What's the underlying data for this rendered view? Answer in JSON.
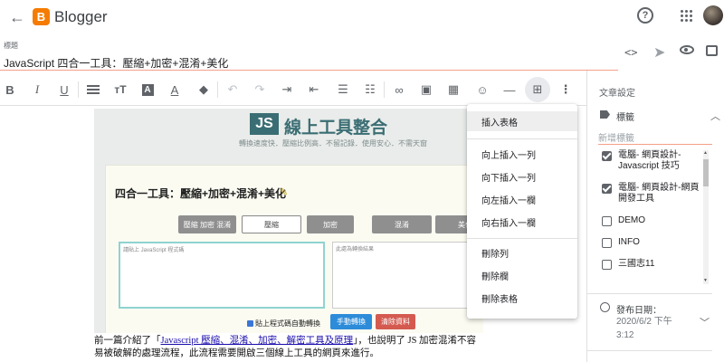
{
  "appbar": {
    "title": "Blogger",
    "logo_letter": "B"
  },
  "post": {
    "title_label": "標題",
    "title_value": "JavaScript 四合一工具：壓縮+加密+混淆+美化"
  },
  "toolbar": {
    "html_view_icon": "<>"
  },
  "editor_image": {
    "badge": "JS",
    "banner_title": "線上工具整合",
    "banner_subtitle": "轉換速度快．壓縮比例高．不留記錄．使用安心．不需天窗",
    "card_title": "四合一工具：壓縮+加密+混淆+美化",
    "buttons": [
      "壓縮 加密 混淆",
      "壓縮",
      "加密",
      "混淆",
      "美化"
    ],
    "input_placeholder": "請貼上 JavaScript 程式碼",
    "output_placeholder": "此處為轉換結果",
    "auto_convert_label": "貼上程式碼自動轉換",
    "convert_button": "手動轉換",
    "clear_button": "清除資料"
  },
  "paragraph": {
    "before": "前一篇介紹了「",
    "link": "Javascript 壓縮、混淆、加密、解密工具及原理",
    "after": "」，也說明了 JS 加密混淆不容易被破解的處理流程，此流程需要開啟三個線上工具的網頁來進行。"
  },
  "table_menu": {
    "items": [
      "插入表格",
      "向上插入一列",
      "向下插入一列",
      "向左插入一欄",
      "向右插入一欄",
      "刪除列",
      "刪除欄",
      "刪除表格"
    ]
  },
  "settings": {
    "title": "文章設定",
    "labels_heading": "標籤",
    "new_label_placeholder": "新增標籤",
    "labels": [
      {
        "text": "電腦- 網頁設計- Javascript 技巧",
        "checked": true
      },
      {
        "text": "電腦- 網頁設計-網頁開發工具",
        "checked": true
      },
      {
        "text": "DEMO",
        "checked": false
      },
      {
        "text": "INFO",
        "checked": false
      },
      {
        "text": "三國志11",
        "checked": false
      }
    ],
    "publish_label": "發布日期：",
    "publish_value": "2020/6/2 下午 3:12"
  }
}
